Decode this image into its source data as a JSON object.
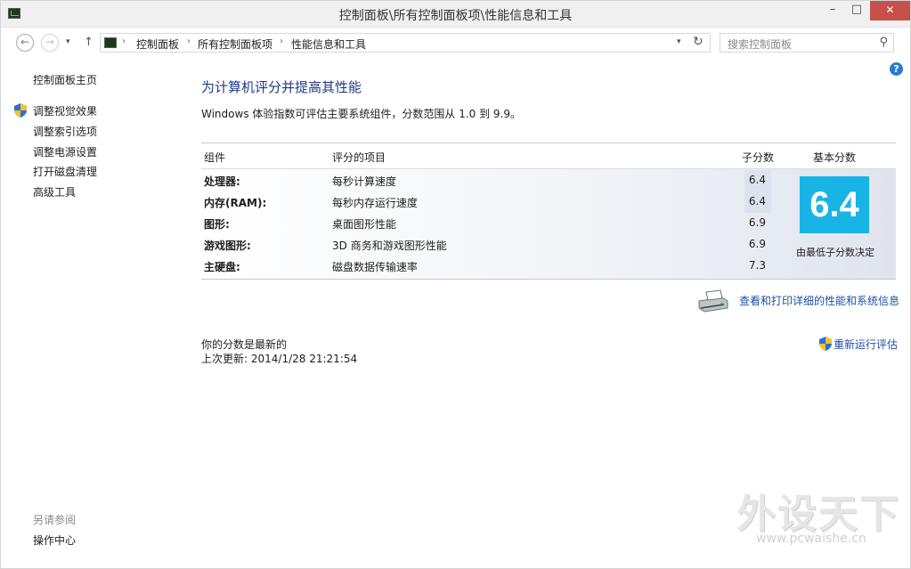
{
  "window": {
    "title": "控制面板\\所有控制面板项\\性能信息和工具",
    "minimize": "–",
    "maximize": "□",
    "close": "✕"
  },
  "nav": {
    "back": "←",
    "forward": "→",
    "recent": "▾",
    "up": "↑",
    "breadcrumb": [
      "控制面板",
      "所有控制面板项",
      "性能信息和工具"
    ],
    "separator": "›",
    "address_dropdown": "▾",
    "refresh": "↻",
    "search_placeholder": "搜索控制面板",
    "search_glyph": "⚲"
  },
  "sidebar": {
    "home": "控制面板主页",
    "links": [
      "调整视觉效果",
      "调整索引选项",
      "调整电源设置",
      "打开磁盘清理",
      "高级工具"
    ],
    "see_also_label": "另请参阅",
    "see_also_links": [
      "操作中心"
    ]
  },
  "main": {
    "help": "?",
    "heading": "为计算机评分并提高其性能",
    "intro": "Windows 体验指数可评估主要系统组件，分数范围从 1.0 到 9.9。",
    "table": {
      "headers": {
        "component": "组件",
        "rated": "评分的项目",
        "subscore": "子分数",
        "base": "基本分数"
      },
      "rows": [
        {
          "component": "处理器:",
          "item": "每秒计算速度",
          "score": "6.4"
        },
        {
          "component": "内存(RAM):",
          "item": "每秒内存运行速度",
          "score": "6.4"
        },
        {
          "component": "图形:",
          "item": "桌面图形性能",
          "score": "6.9"
        },
        {
          "component": "游戏图形:",
          "item": "3D 商务和游戏图形性能",
          "score": "6.9"
        },
        {
          "component": "主硬盘:",
          "item": "磁盘数据传输速率",
          "score": "7.3"
        }
      ],
      "base_score": "6.4",
      "base_caption": "由最低子分数决定",
      "tile_color": "#19b4e6"
    },
    "detail_link": "查看和打印详细的性能和系统信息",
    "status_line1": "你的分数是最新的",
    "status_line2": "上次更新: 2014/1/28 21:21:54",
    "rerun_link": "重新运行评估"
  },
  "watermark": {
    "logo": "外设天下",
    "url": "www.pcwaishe.cn"
  }
}
